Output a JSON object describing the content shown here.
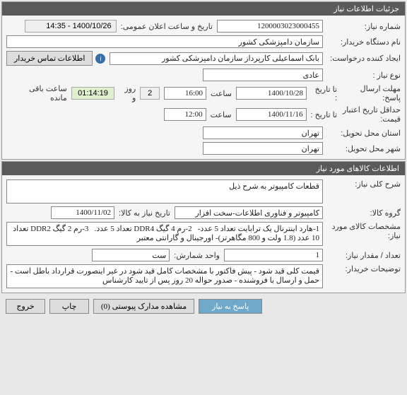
{
  "panel1": {
    "title": "جزئیات اطلاعات نیاز",
    "need_no_label": "شماره نیاز:",
    "need_no": "1200003023000455",
    "announce_label": "تاریخ و ساعت اعلان عمومی:",
    "announce_value": "1400/10/26 - 14:35",
    "buyer_org_label": "نام دستگاه خریدار:",
    "buyer_org": "سازمان دامپزشکی کشور",
    "creator_label": "ایجاد کننده درخواست:",
    "creator": "بابک اسماعیلی کارپرداز سازمان دامپزشکی کشور",
    "contact_btn": "اطلاعات تماس خریدار",
    "need_type_label": "نوع نیاز :",
    "need_type": "عادی",
    "reply_deadline_label": "مهلت ارسال پاسخ:",
    "to_date_label": "تا تاریخ :",
    "reply_date": "1400/10/28",
    "time_label": "ساعت",
    "reply_time": "16:00",
    "days_left": "2",
    "days_unit": "روز و",
    "time_left": "01:14:19",
    "time_unit": "ساعت باقی مانده",
    "price_validity_label": "حداقل تاریخ اعتبار قیمت:",
    "price_date": "1400/11/16",
    "price_time": "12:00",
    "deliver_state_label": "استان محل تحویل:",
    "deliver_state": "تهران",
    "deliver_city_label": "شهر محل تحویل:",
    "deliver_city": "تهران"
  },
  "panel2": {
    "title": "اطلاعات کالاهای مورد نیاز",
    "desc_label": "شرح کلی نیاز:",
    "desc": "قطعات کامپیوتر به شرح ذیل",
    "group_label": "گروه کالا:",
    "group": "کامپیوتر و فناوری اطلاعات-سخت افزار",
    "need_date_label": "تاریخ نیاز به کالا:",
    "need_date": "1400/11/02",
    "spec_label": "مشخصات کالای مورد نیاز:",
    "spec": "1-هارد اینترنال یک ترابایت تعداد 5 عدد-   2-رم 4 گیگ DDR4 تعداد 5 عدد.   3-رم 2 گیگ DDR2 تعداد 10 عدد (1.8 ولت و 800 مگاهرتز)- اورجینال و گارانتی معتبر",
    "qty_label": "تعداد / مقدار نیاز:",
    "qty": "1",
    "unit_label": "واحد شمارش:",
    "unit": "ست",
    "notes_label": "توضیحات خریدار:",
    "notes": "قیمت کلی قید شود - پیش فاکتور با مشخصات کامل قید شود در غیر اینصورت قرارداد باطل است - حمل و ارسال با فروشنده - صدور حواله 20 روز پس از تایید کارشناس"
  },
  "footer": {
    "reply": "پاسخ به نیاز",
    "attachments": "مشاهده مدارک پیوستی (0)",
    "print": "چاپ",
    "exit": "خروج"
  }
}
